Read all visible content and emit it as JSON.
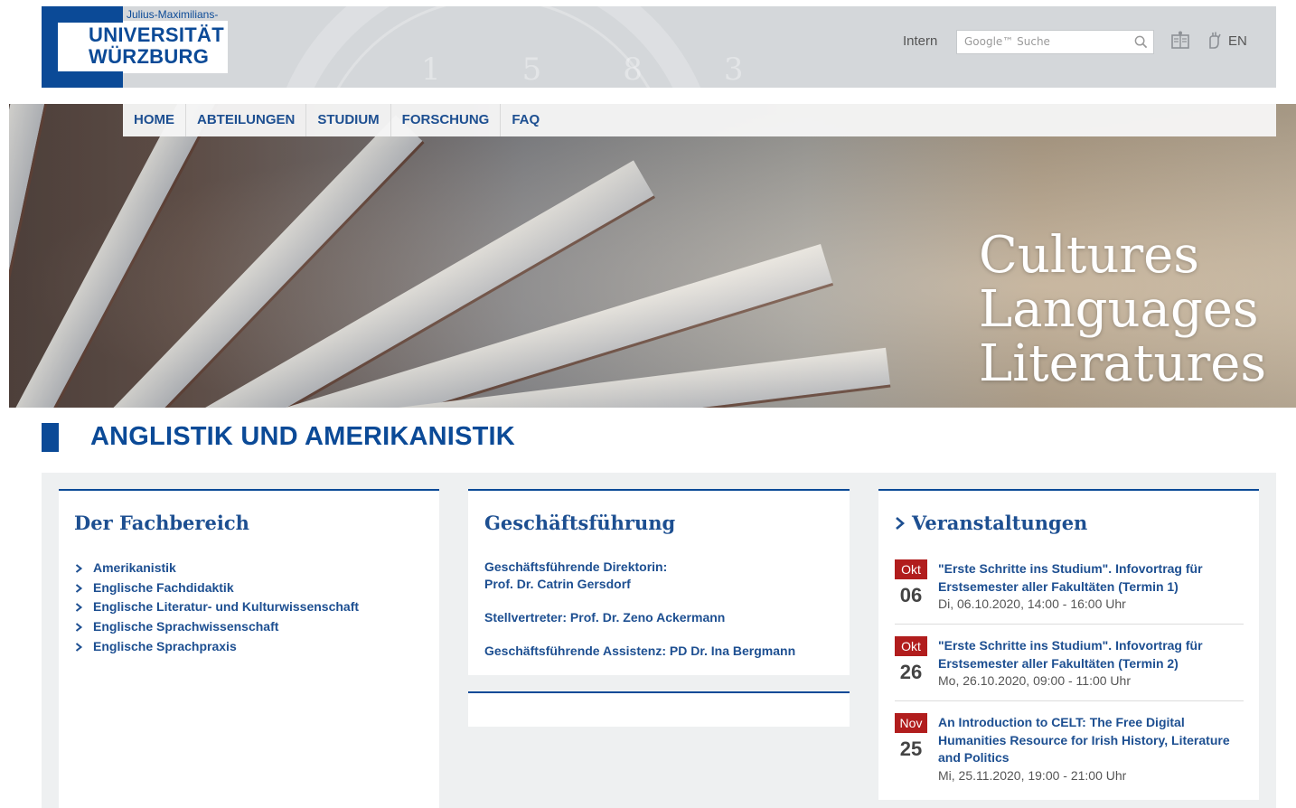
{
  "header": {
    "university_small": "Julius-Maximilians-",
    "university_line1": "UNIVERSITÄT",
    "university_line2": "WÜRZBURG",
    "intern_label": "Intern",
    "search_placeholder": "Google™ Suche",
    "language_label": "EN"
  },
  "nav": {
    "items": [
      "HOME",
      "ABTEILUNGEN",
      "STUDIUM",
      "FORSCHUNG",
      "FAQ"
    ]
  },
  "hero": {
    "lines": [
      "Cultures",
      "Languages",
      "Literatures"
    ]
  },
  "page_title": "ANGLISTIK UND AMERIKANISTIK",
  "fachbereich": {
    "heading": "Der Fachbereich",
    "links": [
      "Amerikanistik",
      "Englische Fachdidaktik",
      "Englische Literatur- und Kulturwissenschaft",
      "Englische Sprachwissenschaft",
      "Englische Sprachpraxis"
    ]
  },
  "geschaeftsfuehrung": {
    "heading": "Geschäftsführung",
    "director_label": "Geschäftsführende Direktorin:",
    "director_name": "Prof. Dr. Catrin Gersdorf",
    "deputy": "Stellvertreter: Prof. Dr. Zeno Ackermann",
    "assistant": "Geschäftsführende Assistenz: PD Dr. Ina Bergmann"
  },
  "veranstaltungen": {
    "heading": "Veranstaltungen",
    "events": [
      {
        "month": "Okt",
        "day": "06",
        "title": "\"Erste Schritte ins Studium\". Infovortrag für Erstsemester aller Fakultäten (Termin 1)",
        "datetime": "Di, 06.10.2020, 14:00 - 16:00 Uhr"
      },
      {
        "month": "Okt",
        "day": "26",
        "title": "\"Erste Schritte ins Studium\". Infovortrag für Erstsemester aller Fakultäten (Termin 2)",
        "datetime": "Mo, 26.10.2020, 09:00 - 11:00 Uhr"
      },
      {
        "month": "Nov",
        "day": "25",
        "title": "An Introduction to CELT: The Free Digital Humanities Resource for Irish History, Literature and Politics",
        "datetime": "Mi, 25.11.2020, 19:00 - 21:00 Uhr"
      }
    ]
  },
  "colors": {
    "brand_blue": "#0b4a97",
    "link_blue": "#1d4f91",
    "event_red": "#b11d1d",
    "header_gray": "#d4d7da"
  }
}
